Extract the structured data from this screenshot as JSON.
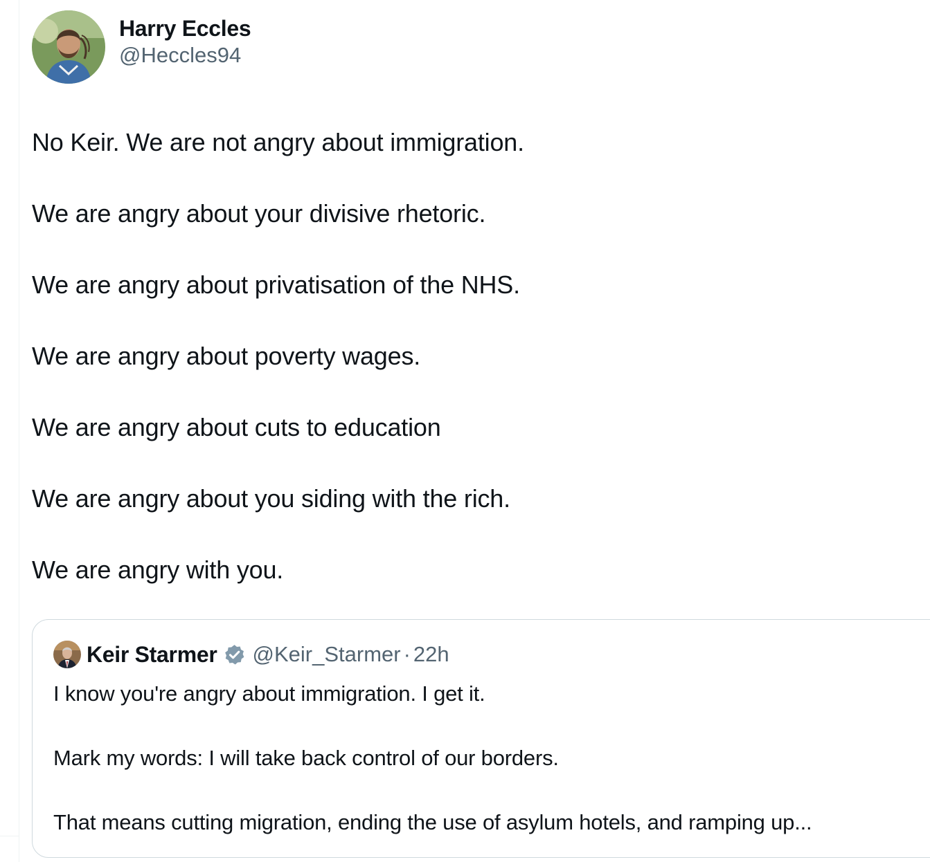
{
  "tweet": {
    "author": {
      "name": "Harry Eccles",
      "handle": "@Heccles94"
    },
    "lines": [
      "No Keir. We are not angry about immigration.",
      "We are angry about your divisive rhetoric.",
      "We are angry about privatisation of the NHS.",
      "We are angry about poverty wages.",
      "We are angry about cuts to education",
      "We are angry about you siding with the rich.",
      "We are angry with you."
    ]
  },
  "quote": {
    "author": {
      "name": "Keir Starmer",
      "handle": "@Keir_Starmer",
      "separator": "·",
      "time": "22h",
      "verified": true,
      "verified_color": "#829aab"
    },
    "lines": [
      "I know you're angry about immigration. I get it.",
      "Mark my words: I will take back control of our borders.",
      "That means cutting migration, ending the use of asylum hotels, and ramping up..."
    ]
  },
  "icons": {
    "verified": "verified-badge-icon"
  }
}
